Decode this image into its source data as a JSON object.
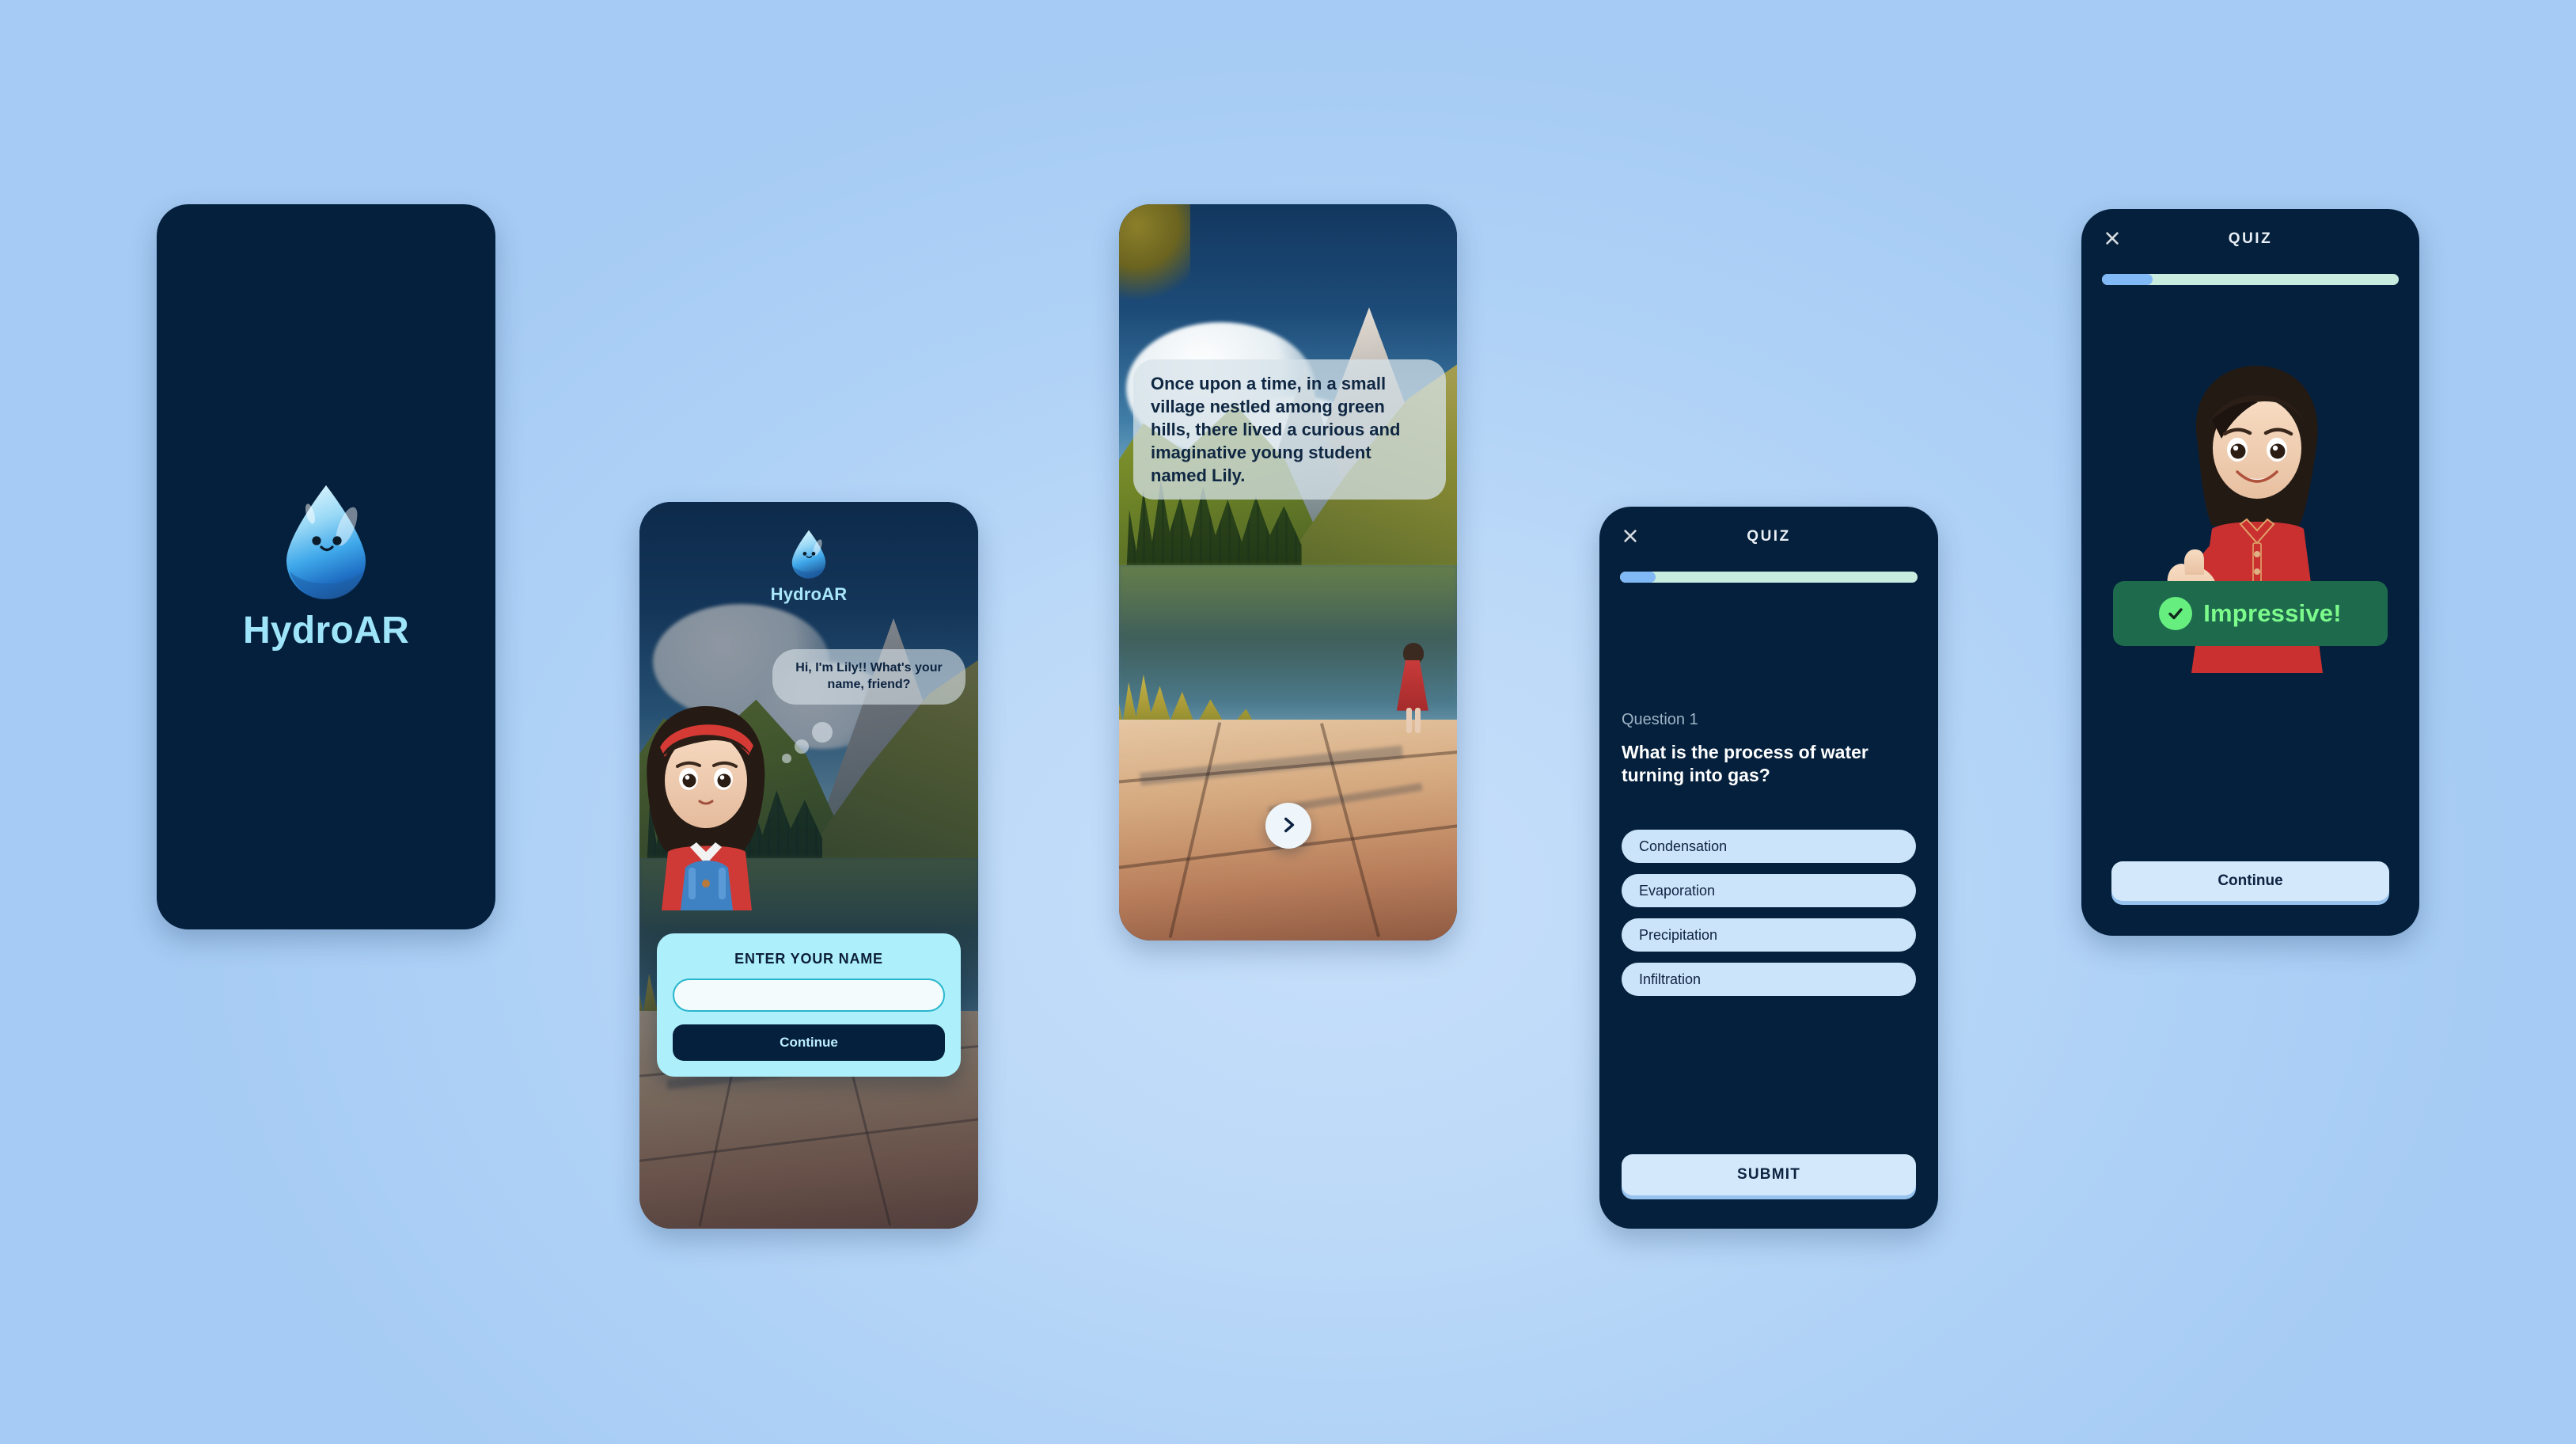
{
  "app": {
    "name": "HydroAR",
    "accent_cyan": "#9fe5fa",
    "screen_bg": "#04203d",
    "page_bg": "#b6d6f7"
  },
  "screens": {
    "splash": {
      "brand": "HydroAR",
      "logo_icon": "water-droplet-mascot-icon"
    },
    "name_entry": {
      "brand": "HydroAR",
      "logo_icon": "water-droplet-mascot-icon",
      "character_icon": "lily-character-portrait",
      "greeting": "Hi, I'm Lily!! What's your name, friend?",
      "card_title": "ENTER YOUR NAME",
      "name_value": "",
      "name_placeholder": "",
      "continue_label": "Continue",
      "card_color": "#adf0fb"
    },
    "story": {
      "narration": "Once upon a time, in a small village nestled among green hills, there lived a curious and imaginative young student named Lily.",
      "next_icon": "chevron-right-icon"
    },
    "quiz": {
      "title": "QUIZ",
      "close_icon": "close-icon",
      "progress_percent": 12,
      "progress_fill_color": "#80b9f6",
      "progress_track_color": "#c9ece0",
      "question_number": "Question 1",
      "question_text": "What is the process of water turning into gas?",
      "options": [
        "Condensation",
        "Evaporation",
        "Precipitation",
        "Infiltration"
      ],
      "submit_label": "SUBMIT"
    },
    "result": {
      "title": "QUIZ",
      "close_icon": "close-icon",
      "progress_percent": 17,
      "character_icon": "lily-thumbs-up-icon",
      "badge_icon": "check-circle-icon",
      "badge_text": "Impressive!",
      "badge_bg": "#1d6b4c",
      "badge_text_color": "#7dfa8c",
      "continue_label": "Continue"
    }
  }
}
